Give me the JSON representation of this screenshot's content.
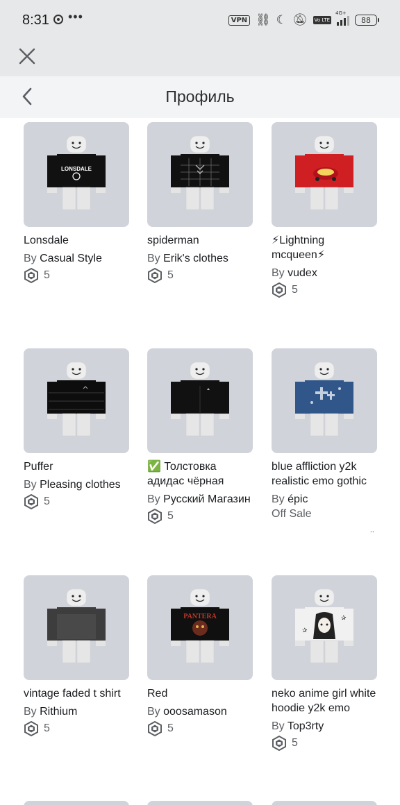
{
  "status_bar": {
    "time": "8:31",
    "vpn": "VPN",
    "volte": "Vo LTE",
    "network": "4G+",
    "battery": "88"
  },
  "header": {
    "title": "Профиль"
  },
  "price_currency_icon": "robux-icon",
  "items": [
    {
      "name": "Lonsdale",
      "by": "By",
      "creator": "Casual Style",
      "price": "5",
      "shirt_color": "#111111",
      "print_color": "#ffffff",
      "print": "LONSDALE"
    },
    {
      "name": "spiderman",
      "by": "By",
      "creator": "Erik's clothes",
      "price": "5",
      "shirt_color": "#111111",
      "print_color": "#6a6a6a",
      "print": "web"
    },
    {
      "name": "⚡Lightning mcqueen⚡",
      "by": "By",
      "creator": "vudex",
      "price": "5",
      "shirt_color": "#cf1f23",
      "print_color": "#f0f0f0",
      "print": "car"
    },
    {
      "name": "Puffer",
      "by": "By",
      "creator": "Pleasing clothes",
      "price": "5",
      "shirt_color": "#0d0d0d",
      "print_color": "#3a3a3a",
      "print": "puffer"
    },
    {
      "name": "✅ Толстовка адидас чёрная",
      "by": "By",
      "creator": "Русский Магазин",
      "price": "5",
      "shirt_color": "#111111",
      "print_color": "#bbbbbb",
      "print": "logo"
    },
    {
      "name": "blue affliction y2k realistic emo gothic",
      "by": "By",
      "creator": "épic",
      "offsale": "Off Sale",
      "shirt_color": "#31578a",
      "print_color": "#dfe6ee",
      "print": "cross"
    },
    {
      "name": "vintage faded t shirt",
      "by": "By",
      "creator": "Rithium",
      "price": "5",
      "shirt_color": "#3d3d3d",
      "print_color": "#555555",
      "print": "faded"
    },
    {
      "name": "Red",
      "by": "By",
      "creator": "ooosamason",
      "price": "5",
      "shirt_color": "#101010",
      "print_color": "#c0392b",
      "print": "PANTERA"
    },
    {
      "name": "neko anime girl white hoodie y2k emo",
      "by": "By",
      "creator": "Top3rty",
      "price": "5",
      "shirt_color": "#f1f1f1",
      "print_color": "#222222",
      "print": "anime"
    }
  ],
  "offsale_more": ".."
}
